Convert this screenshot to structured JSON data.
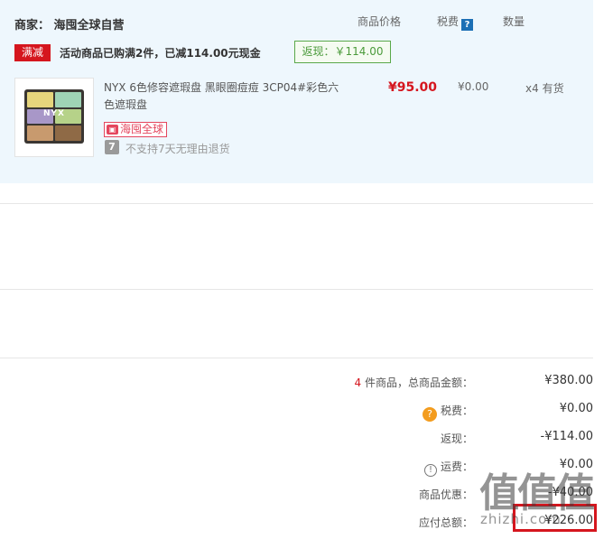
{
  "header": {
    "merchant": "商家：  海囤全球自营",
    "col_price": "商品价格",
    "col_tax": "税费",
    "tax_help": "?",
    "col_qty": "数量"
  },
  "promo": {
    "tag": "满减",
    "text": "活动商品已购满2件，已减114.00元现金",
    "rebate": "返现：￥114.00"
  },
  "product": {
    "logo": "NYX",
    "name": "NYX 6色修容遮瑕盘 黑眼圈痘痘 3CP04#彩色六色遮瑕盘",
    "price": "¥95.00",
    "tax": "¥0.00",
    "qty": "x4",
    "stock": "有货",
    "global_tag": "海囤全球",
    "global_icon": "bag-icon",
    "noreturn_icon": "7",
    "noreturn_text": "不支持7天无理由退货",
    "palette_colors": [
      "#e6d57c",
      "#9fd3b5",
      "#a897c8",
      "#b6d289",
      "#c89a6e",
      "#8f6a46"
    ]
  },
  "summary": {
    "count_num": "4",
    "count_label": " 件商品，总商品金额：",
    "total": "¥380.00",
    "tax_icon": "?",
    "tax_label": "税费：",
    "tax_value": "¥0.00",
    "rebate_label": "返现：",
    "rebate_value": "-¥114.00",
    "shipping_icon": "!",
    "shipping_label": "运费：",
    "shipping_value": "¥0.00",
    "discount_label": "商品优惠：",
    "discount_value": "-¥40.00",
    "payable_label": "应付总额：",
    "payable_value": "¥226.00"
  },
  "watermark": {
    "main": "值值值",
    "sub": "zhizhi.com"
  }
}
